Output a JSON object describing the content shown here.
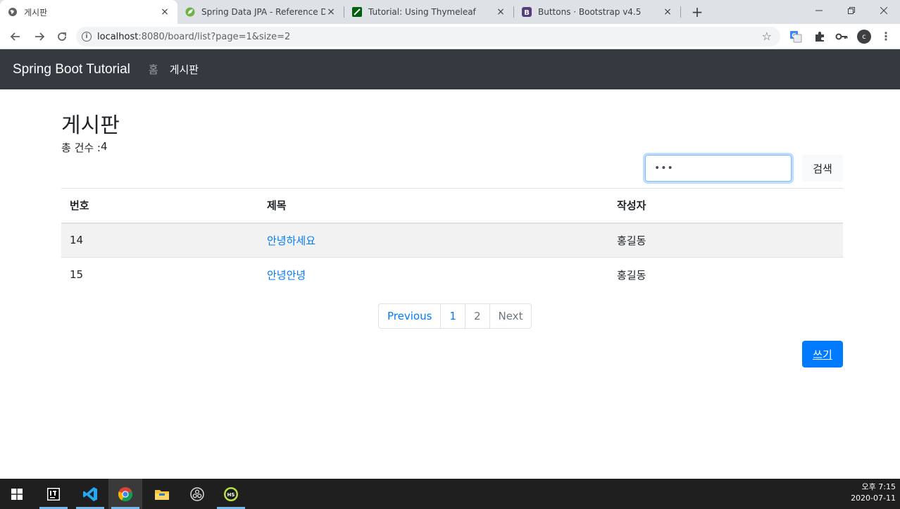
{
  "browser": {
    "tabs": [
      {
        "title": "게시판",
        "favicon": "globe-icon",
        "active": true
      },
      {
        "title": "Spring Data JPA - Reference Do",
        "favicon": "spring-leaf-icon",
        "active": false
      },
      {
        "title": "Tutorial: Using Thymeleaf",
        "favicon": "thymeleaf-icon",
        "active": false
      },
      {
        "title": "Buttons · Bootstrap v4.5",
        "favicon": "bootstrap-icon",
        "active": false
      }
    ],
    "tab_close": "×",
    "new_tab": "+",
    "url_host": "localhost",
    "url_rest": ":8080/board/list?page=1&size=2",
    "profile_initial": "c"
  },
  "navbar": {
    "brand": "Spring Boot Tutorial",
    "links": [
      {
        "label": "홈",
        "active": false
      },
      {
        "label": "게시판",
        "active": true
      }
    ]
  },
  "page": {
    "title": "게시판",
    "count_label": "총 건수 : ",
    "count_value": "4",
    "search_value": "•••",
    "search_button": "검색",
    "write_button": "쓰기"
  },
  "table": {
    "headers": [
      "번호",
      "제목",
      "작성자"
    ],
    "rows": [
      {
        "no": "14",
        "title": "안녕하세요",
        "author": "홍길동"
      },
      {
        "no": "15",
        "title": "안녕안녕",
        "author": "홍길동"
      }
    ]
  },
  "pagination": {
    "previous": "Previous",
    "pages": [
      "1",
      "2"
    ],
    "next": "Next"
  },
  "taskbar": {
    "time": "오후 7:15",
    "date": "2020-07-11"
  },
  "colors": {
    "navbar_bg": "#343a40",
    "primary": "#007bff",
    "stripe": "#f2f2f2"
  }
}
